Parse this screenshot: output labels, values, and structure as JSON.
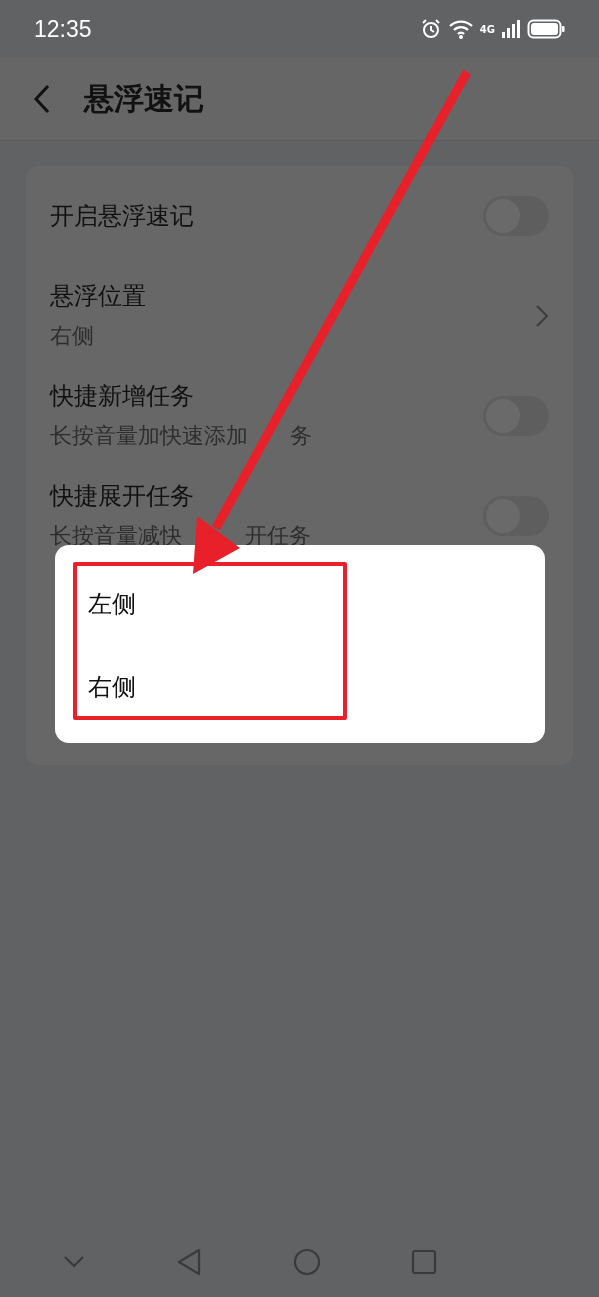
{
  "status_bar": {
    "time": "12:35",
    "network": "4G"
  },
  "header": {
    "title": "悬浮速记"
  },
  "settings": [
    {
      "kind": "toggle",
      "title": "开启悬浮速记",
      "on": false
    },
    {
      "kind": "link",
      "title": "悬浮位置",
      "subtitle_parts": [
        "右侧"
      ]
    },
    {
      "kind": "toggle",
      "title": "快捷新增任务",
      "subtitle_parts": [
        "长按音量加快速添加",
        "务"
      ],
      "on": false
    },
    {
      "kind": "toggle",
      "title": "快捷展开任务",
      "subtitle_parts": [
        "长按音量减快",
        "开任务"
      ],
      "on": false
    }
  ],
  "popup_menu": {
    "items": [
      {
        "label": "左侧",
        "selected": false
      },
      {
        "label": "右侧",
        "selected": false
      }
    ]
  }
}
